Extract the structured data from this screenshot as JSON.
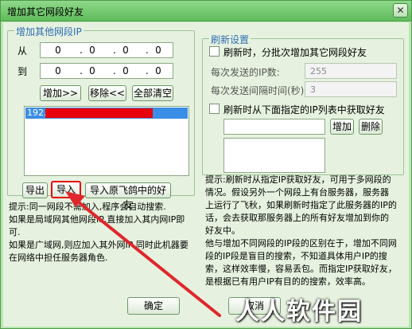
{
  "window": {
    "title": "增加其它网段好友",
    "close_glyph": "✕"
  },
  "left_group": {
    "legend": "增加其他网段IP",
    "from_label": "从",
    "to_label": "到",
    "from_ip": [
      "0",
      "0",
      "0",
      "0"
    ],
    "to_ip": [
      "0",
      "0",
      "0",
      "0"
    ],
    "add_button": "增加>>",
    "remove_button": "移除<<",
    "clear_button": "全部清空",
    "list_items": [
      "192."
    ],
    "export_button": "导出",
    "import_button": "导入",
    "import_original_button": "导入原飞鸽中的好友"
  },
  "left_hint": [
    "提示:同一网段不需加入,程序会自动搜索.",
    "如果是局域网其他网段IP,直接加入其内网IP即",
    "可.",
    "如果是广域网,则应加入其外网IP,同时此机器要",
    "在网络中担任服务器角色."
  ],
  "right_group": {
    "legend": "刷新设置",
    "refresh_checkbox_label": "刷新时，分批次增加其它网段好友",
    "ip_count_label": "每次发送的IP数:",
    "ip_count_value": "255",
    "interval_label": "每次发送间隔时间(秒):",
    "interval_value": "3",
    "from_list_checkbox_label": "刷新时从下面指定的IP列表中获取好友",
    "add_button": "增加",
    "delete_button": "删除"
  },
  "right_hint": [
    "提示:刷新时从指定IP获取好友，可用于多网段的",
    "情况。假设另外一个网段上有台服务器，服务器",
    "上运行了飞秋，如果刷新时指定了此服务器的IP的",
    "话，会去获取那服务器上的所有好友增加到你的",
    "好友中。",
    "他与增加不同网段的IP段的区别在于，增加不同网",
    "段的IP段是盲目的搜索，不知道具体用户IP的搜",
    "索，这样效率慢，容易丢包。而指定IP获取好友，",
    "是根据已有用户IP有目的的搜索，效率高。"
  ],
  "footer": {
    "ok_button": "确定",
    "cancel_button": "取消"
  },
  "watermark": "人人软件园",
  "colors": {
    "highlight_red": "#e8000b",
    "selection_blue": "#3a8ee6",
    "arrow": "#e0262c"
  }
}
